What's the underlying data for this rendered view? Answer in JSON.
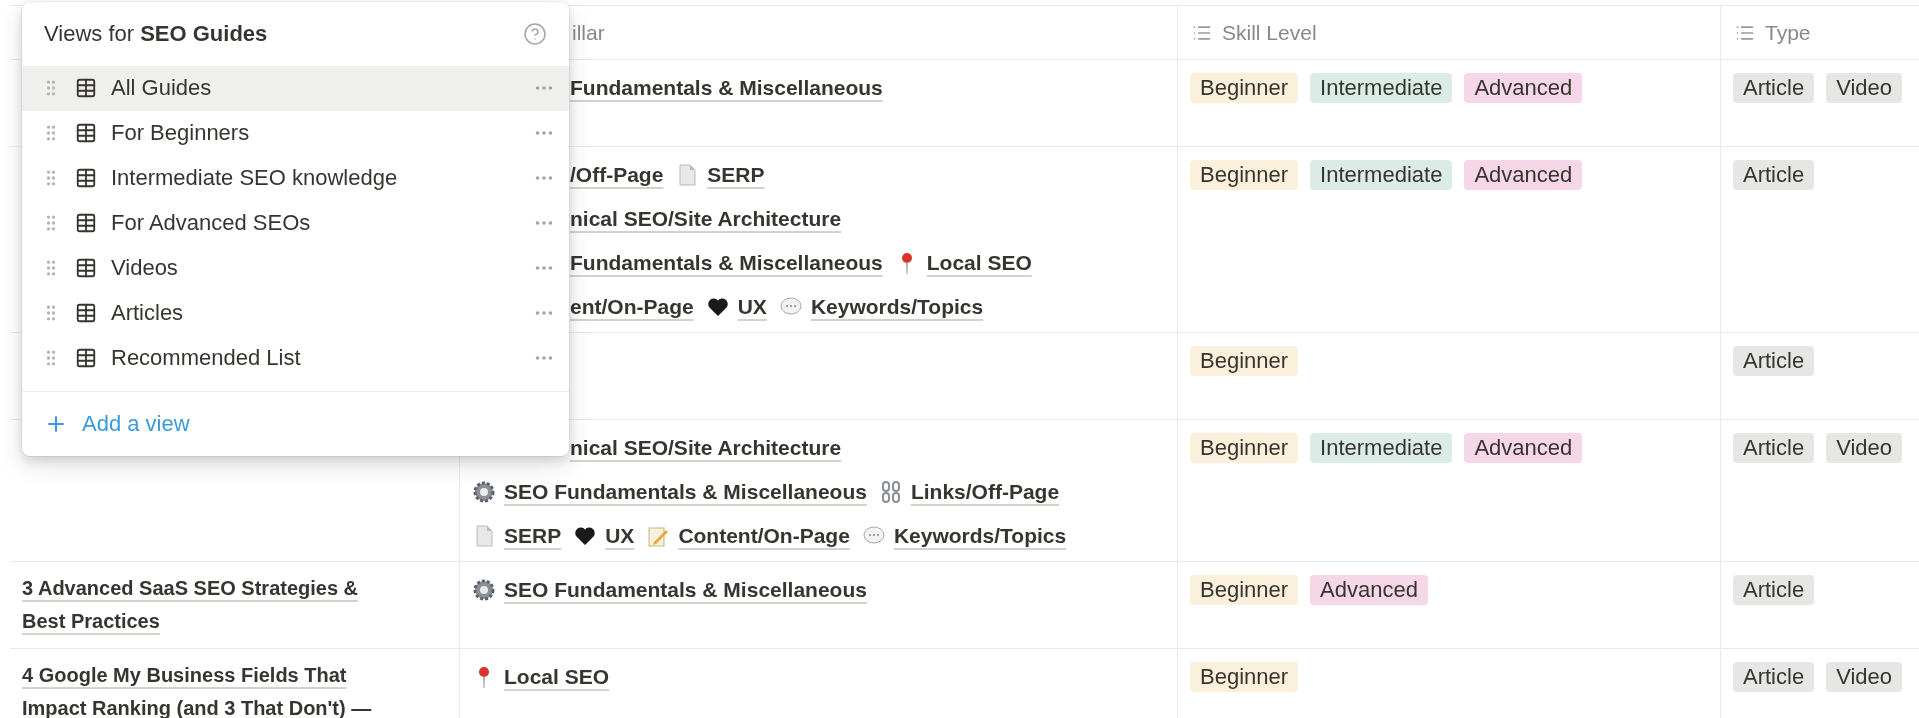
{
  "table": {
    "columns": [
      {
        "label": "illar",
        "icon": false
      },
      {
        "label": "Skill Level",
        "icon": true
      },
      {
        "label": "Type",
        "icon": true
      }
    ],
    "rows": [
      {
        "title": [],
        "pillar": [
          {
            "cut": true,
            "tags": [
              {
                "kind": "none",
                "label": "Fundamentals & Miscellaneous"
              }
            ]
          }
        ],
        "skill": [
          {
            "label": "Beginner",
            "color": "#fbf0dc"
          },
          {
            "label": "Intermediate",
            "color": "#dbece6"
          },
          {
            "label": "Advanced",
            "color": "#f6d7e7"
          }
        ],
        "type": [
          {
            "label": "Article",
            "color": "#e6e6e4"
          },
          {
            "label": "Video",
            "color": "#e6e6e4"
          }
        ]
      },
      {
        "title": [],
        "pillar": [
          {
            "cut": true,
            "tags": [
              {
                "kind": "none",
                "label": "/Off-Page"
              },
              {
                "kind": "page",
                "label": "SERP"
              }
            ]
          },
          {
            "cut": true,
            "tags": [
              {
                "kind": "none",
                "label": "nical SEO/Site Architecture"
              }
            ]
          },
          {
            "cut": true,
            "tags": [
              {
                "kind": "none",
                "label": "Fundamentals & Miscellaneous"
              },
              {
                "kind": "pin",
                "label": "Local SEO"
              }
            ]
          },
          {
            "cut": true,
            "tags": [
              {
                "kind": "none",
                "label": "ent/On-Page"
              },
              {
                "kind": "heart",
                "label": "UX"
              },
              {
                "kind": "speech",
                "label": "Keywords/Topics"
              }
            ]
          }
        ],
        "skill": [
          {
            "label": "Beginner",
            "color": "#fbf0dc"
          },
          {
            "label": "Intermediate",
            "color": "#dbece6"
          },
          {
            "label": "Advanced",
            "color": "#f6d7e7"
          }
        ],
        "type": [
          {
            "label": "Article",
            "color": "#e6e6e4"
          }
        ]
      },
      {
        "title": [],
        "pillar": [],
        "skill": [
          {
            "label": "Beginner",
            "color": "#fbf0dc"
          }
        ],
        "type": [
          {
            "label": "Article",
            "color": "#e6e6e4"
          }
        ]
      },
      {
        "title": [],
        "pillar": [
          {
            "cut": true,
            "tags": [
              {
                "kind": "none",
                "label": "nical SEO/Site Architecture"
              }
            ]
          },
          {
            "cut": false,
            "tags": [
              {
                "kind": "gear",
                "label": "SEO Fundamentals & Miscellaneous"
              },
              {
                "kind": "chain",
                "label": "Links/Off-Page"
              }
            ]
          },
          {
            "cut": false,
            "tags": [
              {
                "kind": "page",
                "label": "SERP"
              },
              {
                "kind": "heart",
                "label": "UX"
              },
              {
                "kind": "memo",
                "label": "Content/On-Page"
              },
              {
                "kind": "speech",
                "label": "Keywords/Topics"
              }
            ]
          }
        ],
        "skill": [
          {
            "label": "Beginner",
            "color": "#fbf0dc"
          },
          {
            "label": "Intermediate",
            "color": "#dbece6"
          },
          {
            "label": "Advanced",
            "color": "#f6d7e7"
          }
        ],
        "type": [
          {
            "label": "Article",
            "color": "#e6e6e4"
          },
          {
            "label": "Video",
            "color": "#e6e6e4"
          }
        ]
      },
      {
        "title": [
          "3 Advanced SaaS SEO Strategies &",
          "Best Practices"
        ],
        "pillar": [
          {
            "cut": false,
            "tags": [
              {
                "kind": "gear",
                "label": "SEO Fundamentals & Miscellaneous"
              }
            ]
          }
        ],
        "skill": [
          {
            "label": "Beginner",
            "color": "#fbf0dc"
          },
          {
            "label": "Advanced",
            "color": "#f6d7e7"
          }
        ],
        "type": [
          {
            "label": "Article",
            "color": "#e6e6e4"
          }
        ]
      },
      {
        "title": [
          "4 Google My Business Fields That",
          "Impact Ranking (and 3 That Don't) —"
        ],
        "pillar": [
          {
            "cut": false,
            "tags": [
              {
                "kind": "pin",
                "label": "Local SEO"
              }
            ]
          }
        ],
        "skill": [
          {
            "label": "Beginner",
            "color": "#fbf0dc"
          }
        ],
        "type": [
          {
            "label": "Article",
            "color": "#e6e6e4"
          },
          {
            "label": "Video",
            "color": "#e6e6e4"
          }
        ]
      }
    ]
  },
  "views_menu": {
    "title": "Views for **SEO Guides**",
    "items": [
      {
        "label": "All Guides",
        "selected": true
      },
      {
        "label": "For Beginners",
        "selected": false
      },
      {
        "label": "Intermediate SEO knowledge",
        "selected": false
      },
      {
        "label": "For Advanced SEOs",
        "selected": false
      },
      {
        "label": "Videos",
        "selected": false
      },
      {
        "label": "Articles",
        "selected": false
      },
      {
        "label": "Recommended List",
        "selected": false
      }
    ],
    "add": "Add a view"
  }
}
